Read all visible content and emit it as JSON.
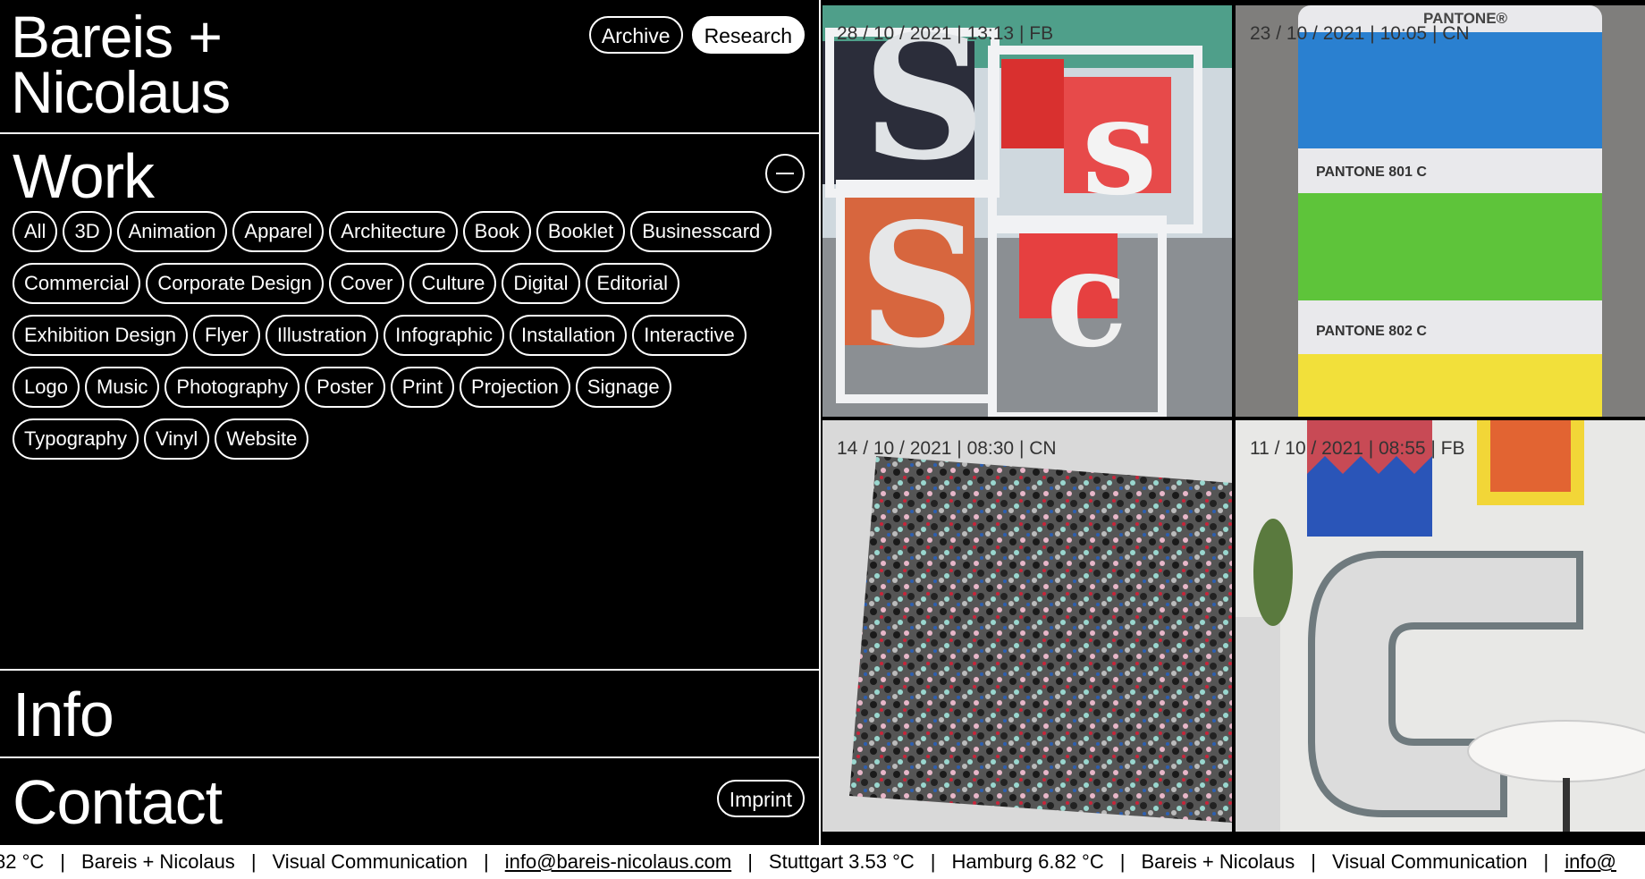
{
  "brand": {
    "line1": "Bareis +",
    "line2": "Nicolaus"
  },
  "nav": {
    "archive": "Archive",
    "research": "Research"
  },
  "work": {
    "title": "Work",
    "tags": [
      "All",
      "3D",
      "Animation",
      "Apparel",
      "Architecture",
      "Book",
      "Booklet",
      "Businesscard",
      "Commercial",
      "Corporate Design",
      "Cover",
      "Culture",
      "Digital",
      "Editorial",
      "Exhibition Design",
      "Flyer",
      "Illustration",
      "Infographic",
      "Installation",
      "Interactive",
      "Logo",
      "Music",
      "Photography",
      "Poster",
      "Print",
      "Projection",
      "Signage",
      "Typography",
      "Vinyl",
      "Website"
    ]
  },
  "info": {
    "title": "Info"
  },
  "contact": {
    "title": "Contact",
    "imprint": "Imprint"
  },
  "grid": [
    {
      "caption": "28 / 10 / 2021 | 13:13 | FB"
    },
    {
      "caption": "23 / 10 / 2021 | 10:05 | CN",
      "swatch_brand": "PANTONE®",
      "swatch_a": "PANTONE 801 C",
      "swatch_b": "PANTONE 802 C"
    },
    {
      "caption": "14 / 10 / 2021 | 08:30 | CN"
    },
    {
      "caption": "11 / 10 / 2021 | 08:55 | FB"
    }
  ],
  "ticker": {
    "items": [
      "82 °C",
      "Bareis + Nicolaus",
      "Visual Communication",
      "info@bareis-nicolaus.com",
      "Stuttgart 3.53 °C",
      "Hamburg 6.82 °C",
      "Bareis + Nicolaus",
      "Visual Communication",
      "info@"
    ],
    "email": "info@bareis-nicolaus.com"
  },
  "colors": {
    "pantone_blue": "#2a80d0",
    "pantone_green": "#5ec43a",
    "pantone_yellow": "#f2e03a"
  }
}
